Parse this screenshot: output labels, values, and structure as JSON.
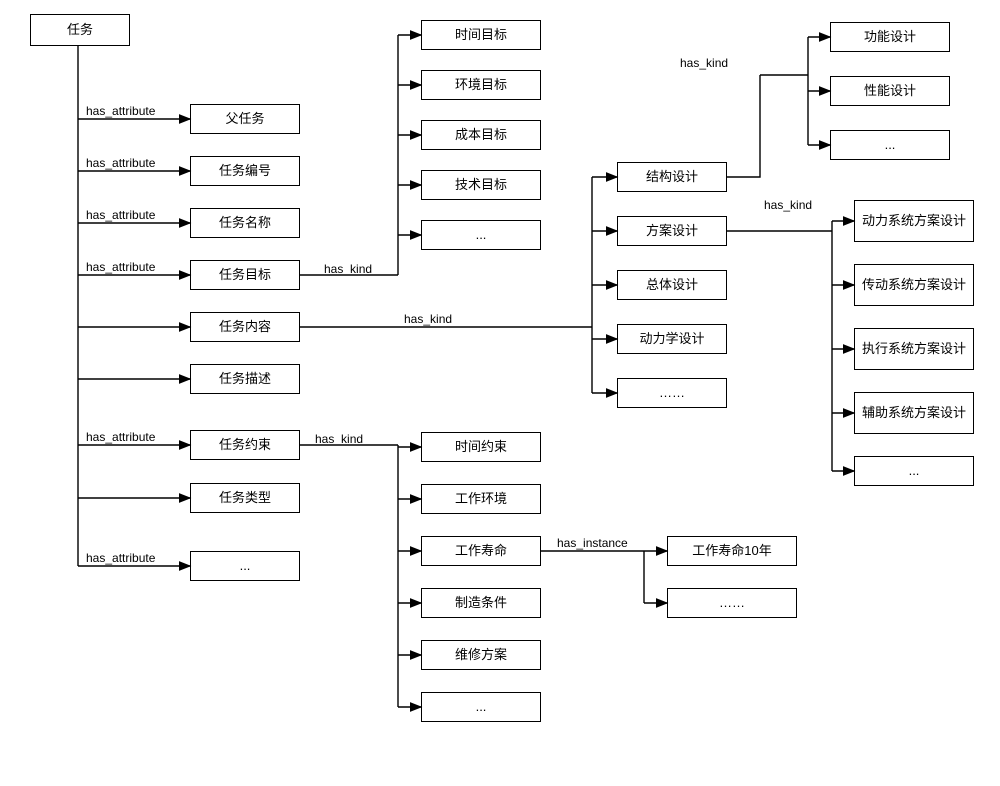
{
  "root": "任务",
  "edge_labels": {
    "has_attribute": "has_attribute",
    "has_kind": "has_kind",
    "has_instance": "has_instance"
  },
  "attributes": [
    "父任务",
    "任务编号",
    "任务名称",
    "任务目标",
    "任务内容",
    "任务描述",
    "任务约束",
    "任务类型",
    "..."
  ],
  "target_kinds": [
    "时间目标",
    "环境目标",
    "成本目标",
    "技术目标",
    "..."
  ],
  "content_kinds": [
    "结构设计",
    "方案设计",
    "总体设计",
    "动力学设计",
    "……"
  ],
  "struct_design_kinds": [
    "功能设计",
    "性能设计",
    "..."
  ],
  "scheme_design_kinds": [
    "动力系统方案设计",
    "传动系统方案设计",
    "执行系统方案设计",
    "辅助系统方案设计",
    "..."
  ],
  "constraint_kinds": [
    "时间约束",
    "工作环境",
    "工作寿命",
    "制造条件",
    "维修方案",
    "..."
  ],
  "lifetime_instances": [
    "工作寿命10年",
    "……"
  ]
}
